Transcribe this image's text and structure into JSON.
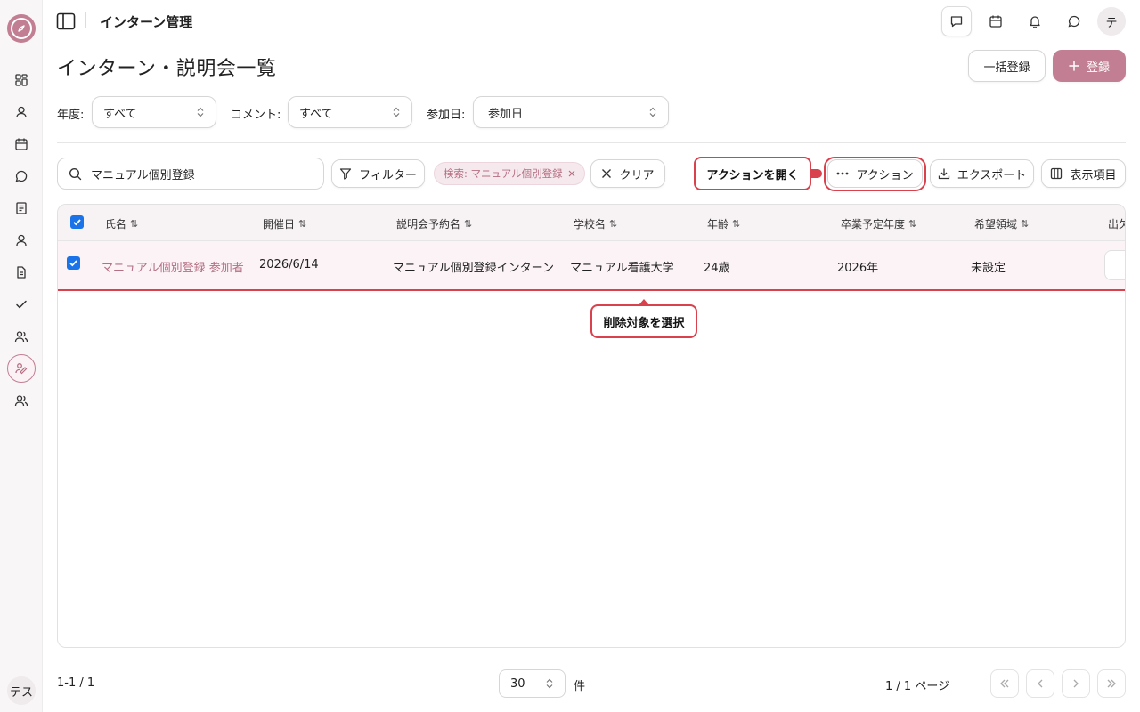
{
  "app": {
    "title": "インターン管理"
  },
  "sidebar": {
    "items": [
      {
        "icon": "dashboard-icon"
      },
      {
        "icon": "user-icon"
      },
      {
        "icon": "calendar-icon"
      },
      {
        "icon": "chat-icon"
      },
      {
        "icon": "notebook-icon"
      },
      {
        "icon": "person-icon"
      },
      {
        "icon": "document-icon"
      },
      {
        "icon": "check-icon"
      },
      {
        "icon": "users-icon"
      },
      {
        "icon": "intern-handshake-icon",
        "active": true
      },
      {
        "icon": "group-icon"
      }
    ],
    "user_initials": "テス"
  },
  "topbar": {
    "user_initial": "テ",
    "icons": [
      "message-square-icon",
      "calendar-icon",
      "bell-icon",
      "chat-bubble-icon"
    ]
  },
  "page": {
    "title": "インターン・説明会一覧",
    "bulk_register_label": "一括登録",
    "register_label": "登録"
  },
  "filters": {
    "year_label": "年度:",
    "year_value": "すべて",
    "comment_label": "コメント:",
    "comment_value": "すべて",
    "date_label": "参加日:",
    "date_value": "参加日"
  },
  "toolbar": {
    "search_value": "マニュアル個別登録",
    "filter_label": "フィルター",
    "chip_label": "検索: マニュアル個別登録",
    "clear_label": "クリア",
    "action_label": "アクション",
    "export_label": "エクスポート",
    "columns_label": "表示項目"
  },
  "callouts": {
    "open_action": "アクションを開く",
    "select_target": "削除対象を選択"
  },
  "table": {
    "headers": [
      "氏名",
      "開催日",
      "説明会予約名",
      "学校名",
      "年齢",
      "卒業予定年度",
      "希望領域",
      "出欠"
    ],
    "sort_glyph": "⇅",
    "rows": [
      {
        "name": "マニュアル個別登録 参加者",
        "date": "2026/6/14",
        "reservation": "マニュアル個別登録インターン",
        "school": "マニュアル看護大学",
        "age": "24歳",
        "grad_year": "2026年",
        "area": "未設定"
      }
    ]
  },
  "footer": {
    "range": "1-1 / 1",
    "page_size": "30",
    "unit": "件",
    "page_info": "1 / 1 ページ"
  },
  "colors": {
    "accent": "#c27f93",
    "highlight_red": "#d9414d",
    "checkbox_blue": "#1a73e8"
  }
}
